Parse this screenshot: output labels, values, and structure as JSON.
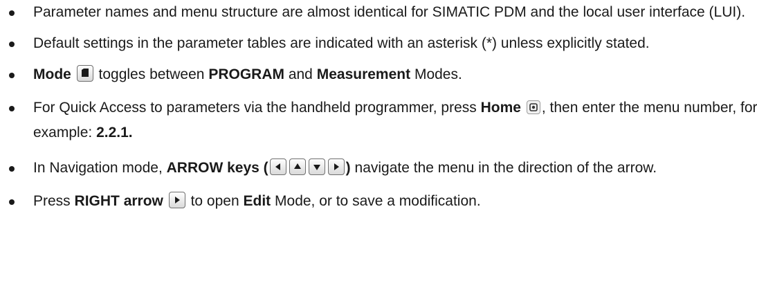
{
  "bullets": {
    "b1": {
      "text": "Parameter names and menu structure are almost identical for SIMATIC PDM and the local user interface (LUI)."
    },
    "b2": {
      "text": "Default settings in the parameter tables are indicated with an asterisk (*) unless explicitly stated."
    },
    "b3": {
      "mode": "Mode",
      "t1": "toggles between",
      "program": "PROGRAM",
      "and": "and",
      "measurement": "Measurement",
      "t2": "Modes.",
      "icon": "mode-key-icon"
    },
    "b4": {
      "t1": "For Quick Access to parameters via the handheld programmer, press",
      "home": "Home",
      "t2": ", then enter the menu number, for example:",
      "example": "2.2.1.",
      "icon": "home-key-icon"
    },
    "b5": {
      "t1": "In Navigation mode,",
      "arrow_keys": "ARROW keys",
      "open": "(",
      "close": ")",
      "t2": "navigate the menu in the direction of the arrow.",
      "icons": [
        "left-arrow-key-icon",
        "up-arrow-key-icon",
        "down-arrow-key-icon",
        "right-arrow-key-icon"
      ]
    },
    "b6": {
      "t1": "Press",
      "right_arrow": "RIGHT arrow",
      "t2": "to open",
      "edit": "Edit",
      "t3": "Mode, or to save a modification.",
      "icon": "right-arrow-key-icon"
    }
  }
}
